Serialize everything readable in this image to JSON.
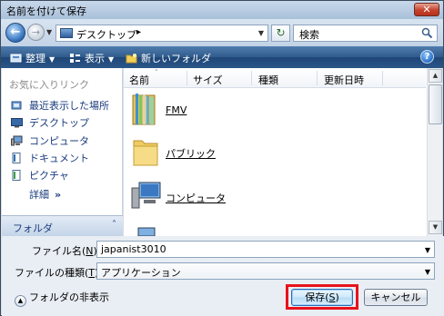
{
  "window": {
    "title": "名前を付けて保存"
  },
  "address": {
    "location": "デスクトップ",
    "chevron": "▸"
  },
  "search": {
    "placeholder": "検索"
  },
  "toolbar": {
    "organize": "整理",
    "views": "表示",
    "new_folder": "新しいフォルダ",
    "help": "?"
  },
  "favorites": {
    "header": "お気に入りリンク",
    "items": [
      {
        "label": "最近表示した場所",
        "icon": "recent-places-icon"
      },
      {
        "label": "デスクトップ",
        "icon": "desktop-icon"
      },
      {
        "label": "コンピュータ",
        "icon": "computer-icon"
      },
      {
        "label": "ドキュメント",
        "icon": "documents-icon"
      },
      {
        "label": "ピクチャ",
        "icon": "pictures-icon"
      }
    ],
    "more": "詳細",
    "more_glyph": "»"
  },
  "folders_pane": {
    "label": "フォルダ",
    "chevron": "˄"
  },
  "columns": [
    "名前",
    "サイズ",
    "種類",
    "更新日時"
  ],
  "files": [
    {
      "name": "FMV",
      "icon": "library-folder-icon"
    },
    {
      "name": "パブリック",
      "icon": "folder-icon"
    },
    {
      "name": "コンピュータ",
      "icon": "computer-icon"
    }
  ],
  "filename": {
    "label": "ファイル名(N):",
    "label_prefix": "ファイル名(",
    "label_key": "N",
    "label_suffix": "):",
    "value": "japanist3010"
  },
  "filetype": {
    "label_prefix": "ファイルの種類(",
    "label_key": "T",
    "label_suffix": "):",
    "value": "アプリケーション"
  },
  "hide_folders": {
    "label": "フォルダの非表示"
  },
  "buttons": {
    "save_prefix": "保存(",
    "save_key": "S",
    "save_suffix": ")",
    "cancel": "キャンセル"
  },
  "colors": {
    "highlight": "#e8121c",
    "link": "#1a3c7e",
    "toolbar": "#2f5b8c"
  }
}
